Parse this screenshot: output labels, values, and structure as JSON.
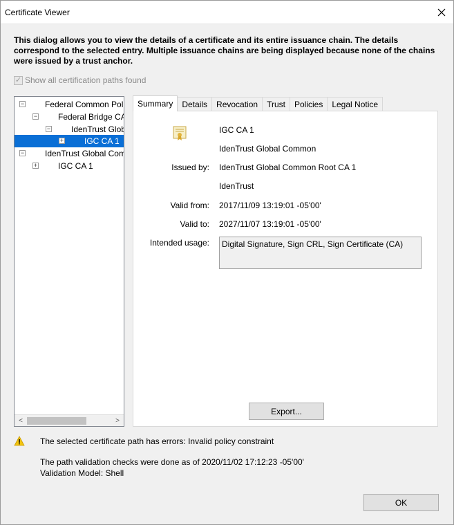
{
  "window": {
    "title": "Certificate Viewer",
    "close_icon": "close-icon"
  },
  "intro": "This dialog allows you to view the details of a certificate and its entire issuance chain. The details correspond to the selected entry. Multiple issuance chains are being displayed because none of the chains were issued by a trust anchor.",
  "show_all": {
    "label": "Show all certification paths found",
    "checked": true,
    "enabled": false
  },
  "tree": {
    "items": [
      {
        "label": "Federal Common Pol",
        "toggle": "⊟",
        "level": 0
      },
      {
        "label": "Federal Bridge CA",
        "toggle": "⊟",
        "level": 1
      },
      {
        "label": "IdenTrust Glob",
        "toggle": "⊟",
        "level": 2
      },
      {
        "label": "IGC CA 1",
        "toggle": "⊞",
        "level": 3,
        "selected": true
      },
      {
        "label": "IdenTrust Global Com",
        "toggle": "⊟",
        "level": 0
      },
      {
        "label": "IGC CA 1",
        "toggle": "⊞",
        "level": 1
      }
    ],
    "scroll_left": "<",
    "scroll_right": ">"
  },
  "tabs": [
    {
      "label": "Summary",
      "active": true
    },
    {
      "label": "Details"
    },
    {
      "label": "Revocation"
    },
    {
      "label": "Trust"
    },
    {
      "label": "Policies"
    },
    {
      "label": "Legal Notice"
    }
  ],
  "summary": {
    "icon": "certificate-icon",
    "subject_name": "IGC CA 1",
    "subject_org": "IdenTrust Global Common",
    "issued_by_label": "Issued by:",
    "issuer_name": "IdenTrust Global Common Root CA 1",
    "issuer_org": "IdenTrust",
    "valid_from_label": "Valid from:",
    "valid_from": "2017/11/09 13:19:01 -05'00'",
    "valid_to_label": "Valid to:",
    "valid_to": "2027/11/07 13:19:01 -05'00'",
    "usage_label": "Intended usage:",
    "usage": "Digital Signature, Sign CRL, Sign Certificate (CA)",
    "export_label": "Export..."
  },
  "status": {
    "warning_icon": "warning-icon",
    "warning": "The selected certificate path has errors: Invalid policy constraint",
    "checked_time": "The path validation checks were done as of 2020/11/02 17:12:23 -05'00'",
    "model": "Validation Model: Shell"
  },
  "ok_label": "OK",
  "colors": {
    "selection": "#0a6fd6",
    "dialog_bg": "#f0f0f0",
    "warning": "#f2c40f"
  }
}
